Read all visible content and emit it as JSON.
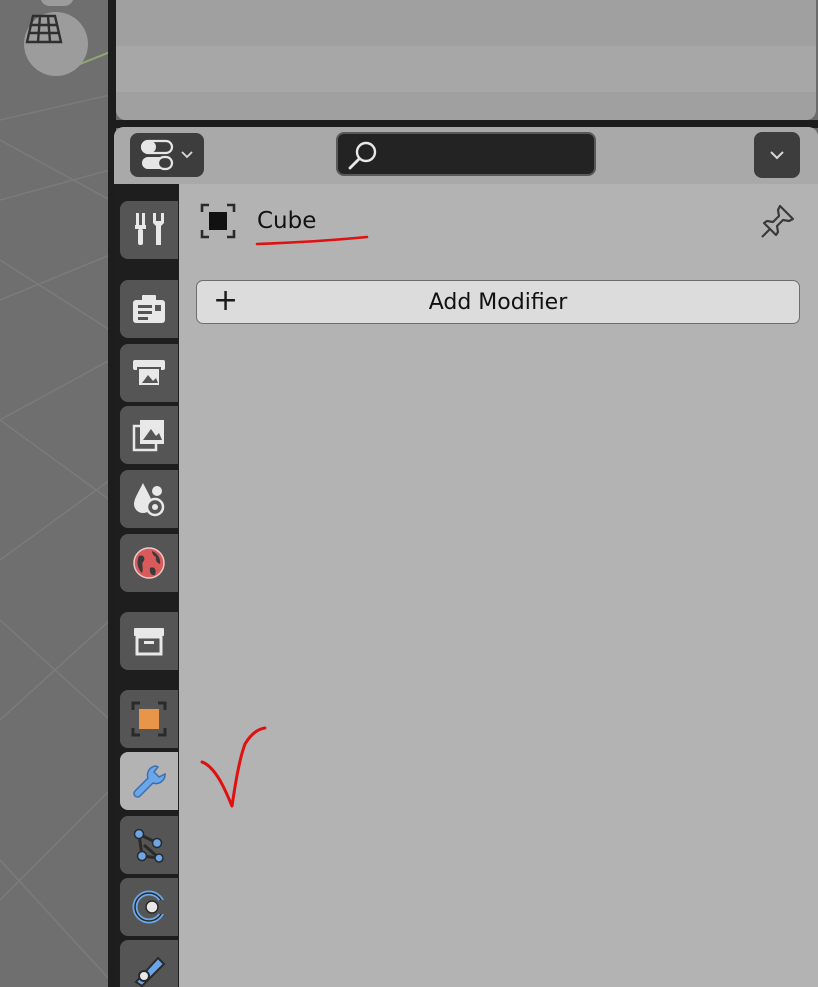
{
  "properties": {
    "header": {
      "editor_type_icon": "properties-editor-icon",
      "search": {
        "icon": "search-icon",
        "value": "",
        "placeholder": ""
      },
      "options_icon": "chevron-down-icon"
    },
    "tabs": [
      {
        "name": "Tool",
        "icon": "tool-icon",
        "active": false
      },
      {
        "name": "Render",
        "icon": "render-icon",
        "active": false
      },
      {
        "name": "Output",
        "icon": "output-icon",
        "active": false
      },
      {
        "name": "View Layer",
        "icon": "view-layer-icon",
        "active": false
      },
      {
        "name": "Scene",
        "icon": "scene-icon",
        "active": false
      },
      {
        "name": "World",
        "icon": "world-icon",
        "active": false
      },
      {
        "name": "Collection",
        "icon": "collection-icon",
        "active": false
      },
      {
        "name": "Object",
        "icon": "object-icon",
        "active": false
      },
      {
        "name": "Modifiers",
        "icon": "wrench-icon",
        "active": true
      },
      {
        "name": "Particles",
        "icon": "particles-icon",
        "active": false
      },
      {
        "name": "Physics",
        "icon": "physics-icon",
        "active": false
      },
      {
        "name": "Constraints",
        "icon": "constraints-icon",
        "active": false
      }
    ],
    "context": {
      "object_name": "Cube",
      "object_icon": "object-icon",
      "pin_icon": "pin-icon"
    },
    "add_modifier": {
      "label": "Add Modifier",
      "icon": "plus-icon"
    }
  },
  "annotations": {
    "underline_color": "#e01010",
    "checkmark_color": "#e01010"
  },
  "colors": {
    "object_orange": "#e8954a",
    "wrench_blue": "#6aa7ea",
    "world_red": "#d95a5a",
    "active_tab": "#b3b3b3"
  }
}
